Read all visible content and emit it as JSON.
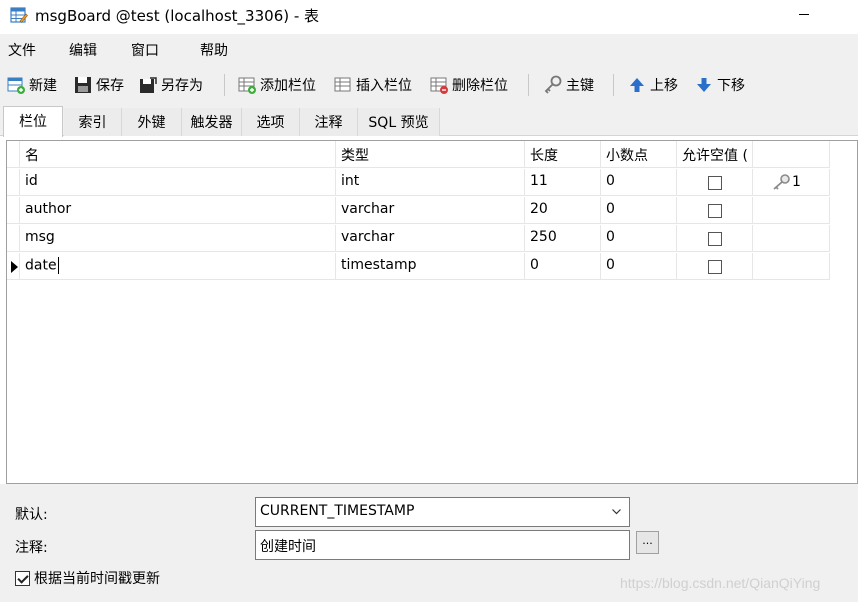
{
  "window": {
    "title": "msgBoard @test (localhost_3306) - 表"
  },
  "menu": [
    "文件",
    "编辑",
    "窗口",
    "帮助"
  ],
  "toolbar": {
    "new_label": "新建",
    "save_label": "保存",
    "save_as_label": "另存为",
    "add_field_label": "添加栏位",
    "insert_field_label": "插入栏位",
    "delete_field_label": "删除栏位",
    "primary_key_label": "主键",
    "move_up_label": "上移",
    "move_down_label": "下移"
  },
  "tabs": [
    "栏位",
    "索引",
    "外键",
    "触发器",
    "选项",
    "注释",
    "SQL 预览"
  ],
  "grid": {
    "columns": [
      "名",
      "类型",
      "长度",
      "小数点",
      "允许空值 ("
    ],
    "rows": [
      {
        "name": "id",
        "type": "int",
        "length": "11",
        "decimals": "0",
        "nullable": false,
        "key": "1"
      },
      {
        "name": "author",
        "type": "varchar",
        "length": "20",
        "decimals": "0",
        "nullable": false,
        "key": ""
      },
      {
        "name": "msg",
        "type": "varchar",
        "length": "250",
        "decimals": "0",
        "nullable": false,
        "key": ""
      },
      {
        "name": "date",
        "type": "timestamp",
        "length": "0",
        "decimals": "0",
        "nullable": false,
        "key": ""
      }
    ]
  },
  "properties": {
    "default_label": "默认:",
    "default_value": "CURRENT_TIMESTAMP",
    "comment_label": "注释:",
    "comment_value": "创建时间",
    "ellipsis_label": "...",
    "update_timestamp_label": "根据当前时间戳更新",
    "update_timestamp_checked": true
  },
  "watermark": "https://blog.csdn.net/QianQiYing"
}
